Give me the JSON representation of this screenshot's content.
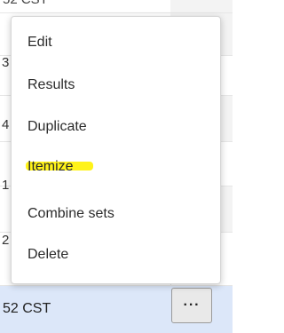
{
  "table": {
    "partial_cells": [
      "3",
      "4",
      "1",
      "2"
    ],
    "top_fragment": "52 CST"
  },
  "selected_row": {
    "text": "52 CST",
    "more_button_label": "···"
  },
  "menu": {
    "items": [
      {
        "label": "Edit"
      },
      {
        "label": "Results"
      },
      {
        "label": "Duplicate"
      },
      {
        "label": "Itemize"
      },
      {
        "label": "Combine sets"
      },
      {
        "label": "Delete"
      }
    ]
  },
  "colors": {
    "selected_row_bg": "#dce7f9",
    "highlighter": "#fff200"
  }
}
